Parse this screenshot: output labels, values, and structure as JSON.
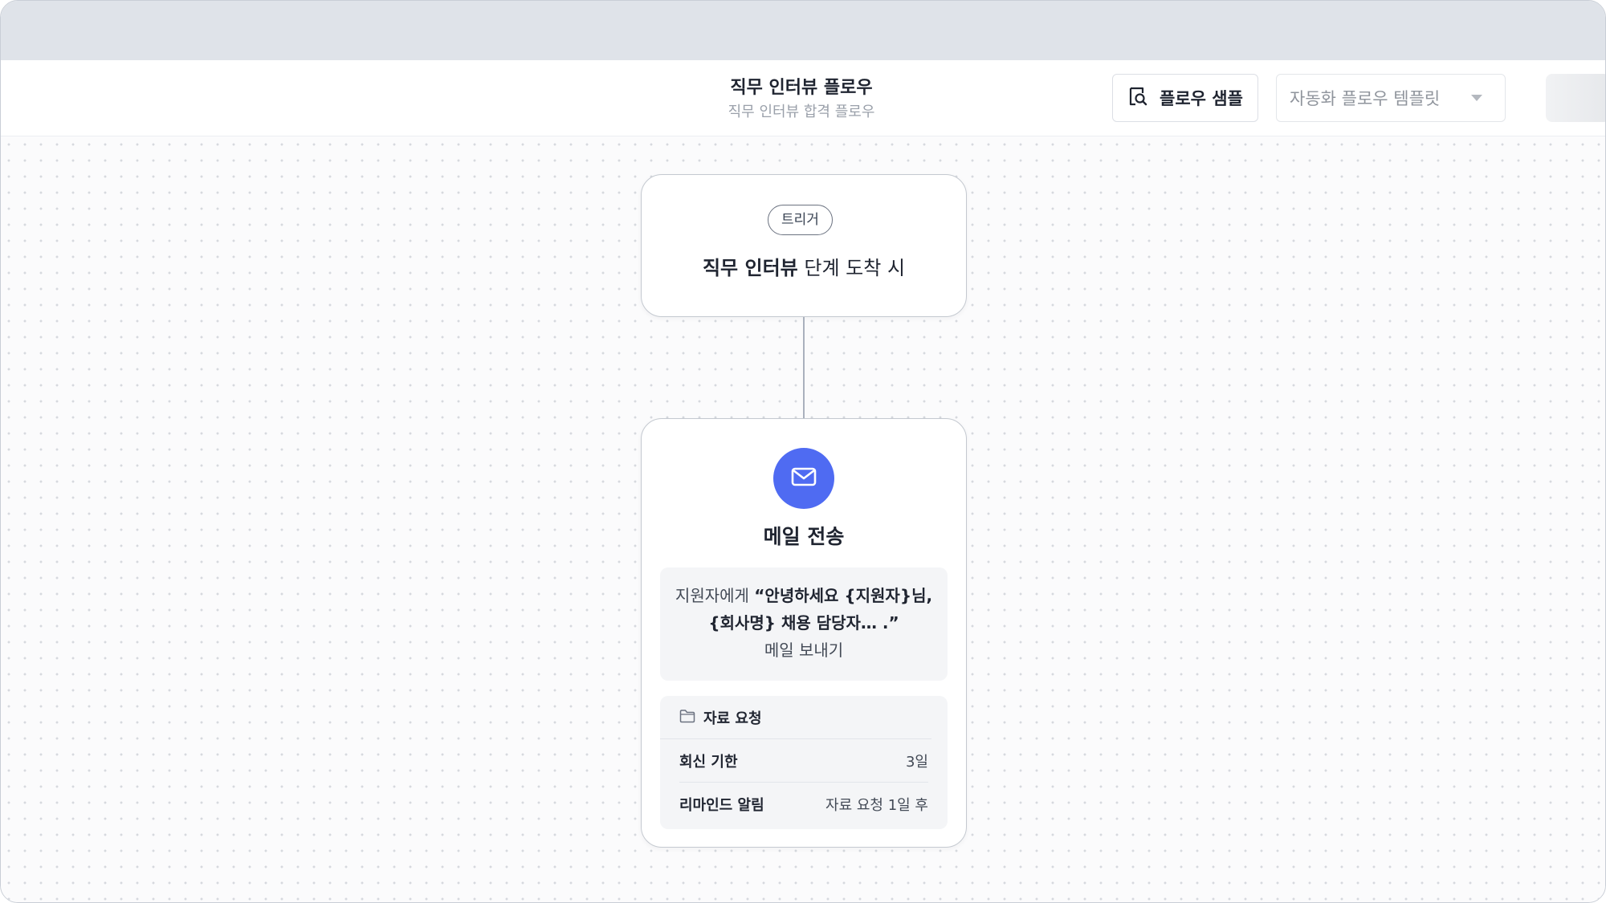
{
  "header": {
    "title": "직무 인터뷰 플로우",
    "subtitle": "직무 인터뷰 합격 플로우",
    "sample_button_label": "플로우 샘플",
    "template_select_value": "자동화 플로우 템플릿"
  },
  "trigger": {
    "badge": "트리거",
    "stage_name": "직무 인터뷰",
    "condition_text": " 단계 도착 시"
  },
  "mail_node": {
    "title": "메일 전송",
    "icon": "mail-icon",
    "accent_color": "#4f6bf2",
    "message_prefix": "지원자에게 ",
    "message_quote": "“안녕하세요 {지원자}님, {회사명} 채용 담당자… .”",
    "message_suffix": "메일 보내기",
    "request": {
      "title": "자료 요청",
      "icon": "folder-icon",
      "rows": [
        {
          "key": "회신 기한",
          "value": "3일"
        },
        {
          "key": "리마인드 알림",
          "value": "자료 요청 1일 후"
        }
      ]
    }
  }
}
